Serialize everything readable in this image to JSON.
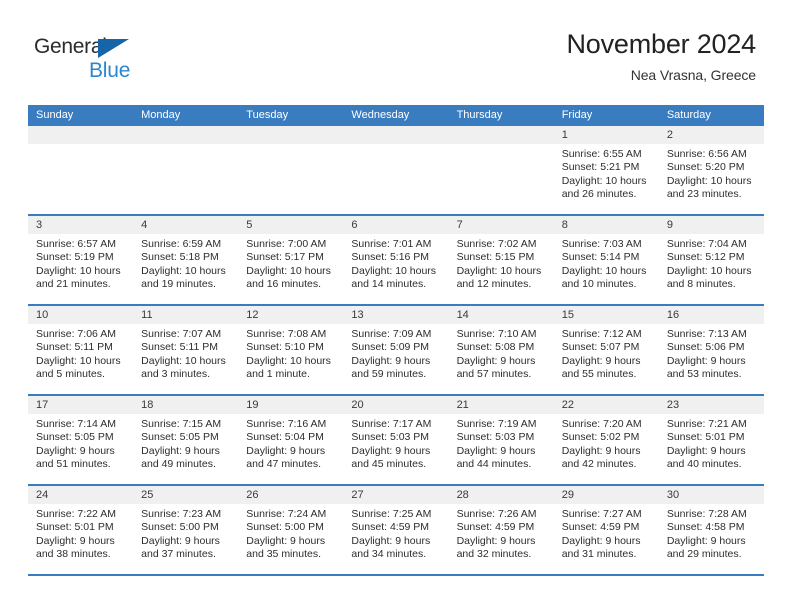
{
  "brand": {
    "name_part1": "General",
    "name_part2": "Blue",
    "accent_color": "#2a87d0",
    "triangle_color": "#1565a8"
  },
  "header": {
    "title": "November 2024",
    "subtitle": "Nea Vrasna, Greece",
    "header_bg_color": "#3a7cc0"
  },
  "weekdays": [
    "Sunday",
    "Monday",
    "Tuesday",
    "Wednesday",
    "Thursday",
    "Friday",
    "Saturday"
  ],
  "weeks": [
    [
      {
        "day": "",
        "empty": true
      },
      {
        "day": "",
        "empty": true
      },
      {
        "day": "",
        "empty": true
      },
      {
        "day": "",
        "empty": true
      },
      {
        "day": "",
        "empty": true
      },
      {
        "day": "1",
        "sunrise": "Sunrise: 6:55 AM",
        "sunset": "Sunset: 5:21 PM",
        "daylight": "Daylight: 10 hours and 26 minutes."
      },
      {
        "day": "2",
        "sunrise": "Sunrise: 6:56 AM",
        "sunset": "Sunset: 5:20 PM",
        "daylight": "Daylight: 10 hours and 23 minutes."
      }
    ],
    [
      {
        "day": "3",
        "sunrise": "Sunrise: 6:57 AM",
        "sunset": "Sunset: 5:19 PM",
        "daylight": "Daylight: 10 hours and 21 minutes."
      },
      {
        "day": "4",
        "sunrise": "Sunrise: 6:59 AM",
        "sunset": "Sunset: 5:18 PM",
        "daylight": "Daylight: 10 hours and 19 minutes."
      },
      {
        "day": "5",
        "sunrise": "Sunrise: 7:00 AM",
        "sunset": "Sunset: 5:17 PM",
        "daylight": "Daylight: 10 hours and 16 minutes."
      },
      {
        "day": "6",
        "sunrise": "Sunrise: 7:01 AM",
        "sunset": "Sunset: 5:16 PM",
        "daylight": "Daylight: 10 hours and 14 minutes."
      },
      {
        "day": "7",
        "sunrise": "Sunrise: 7:02 AM",
        "sunset": "Sunset: 5:15 PM",
        "daylight": "Daylight: 10 hours and 12 minutes."
      },
      {
        "day": "8",
        "sunrise": "Sunrise: 7:03 AM",
        "sunset": "Sunset: 5:14 PM",
        "daylight": "Daylight: 10 hours and 10 minutes."
      },
      {
        "day": "9",
        "sunrise": "Sunrise: 7:04 AM",
        "sunset": "Sunset: 5:12 PM",
        "daylight": "Daylight: 10 hours and 8 minutes."
      }
    ],
    [
      {
        "day": "10",
        "sunrise": "Sunrise: 7:06 AM",
        "sunset": "Sunset: 5:11 PM",
        "daylight": "Daylight: 10 hours and 5 minutes."
      },
      {
        "day": "11",
        "sunrise": "Sunrise: 7:07 AM",
        "sunset": "Sunset: 5:11 PM",
        "daylight": "Daylight: 10 hours and 3 minutes."
      },
      {
        "day": "12",
        "sunrise": "Sunrise: 7:08 AM",
        "sunset": "Sunset: 5:10 PM",
        "daylight": "Daylight: 10 hours and 1 minute."
      },
      {
        "day": "13",
        "sunrise": "Sunrise: 7:09 AM",
        "sunset": "Sunset: 5:09 PM",
        "daylight": "Daylight: 9 hours and 59 minutes."
      },
      {
        "day": "14",
        "sunrise": "Sunrise: 7:10 AM",
        "sunset": "Sunset: 5:08 PM",
        "daylight": "Daylight: 9 hours and 57 minutes."
      },
      {
        "day": "15",
        "sunrise": "Sunrise: 7:12 AM",
        "sunset": "Sunset: 5:07 PM",
        "daylight": "Daylight: 9 hours and 55 minutes."
      },
      {
        "day": "16",
        "sunrise": "Sunrise: 7:13 AM",
        "sunset": "Sunset: 5:06 PM",
        "daylight": "Daylight: 9 hours and 53 minutes."
      }
    ],
    [
      {
        "day": "17",
        "sunrise": "Sunrise: 7:14 AM",
        "sunset": "Sunset: 5:05 PM",
        "daylight": "Daylight: 9 hours and 51 minutes."
      },
      {
        "day": "18",
        "sunrise": "Sunrise: 7:15 AM",
        "sunset": "Sunset: 5:05 PM",
        "daylight": "Daylight: 9 hours and 49 minutes."
      },
      {
        "day": "19",
        "sunrise": "Sunrise: 7:16 AM",
        "sunset": "Sunset: 5:04 PM",
        "daylight": "Daylight: 9 hours and 47 minutes."
      },
      {
        "day": "20",
        "sunrise": "Sunrise: 7:17 AM",
        "sunset": "Sunset: 5:03 PM",
        "daylight": "Daylight: 9 hours and 45 minutes."
      },
      {
        "day": "21",
        "sunrise": "Sunrise: 7:19 AM",
        "sunset": "Sunset: 5:03 PM",
        "daylight": "Daylight: 9 hours and 44 minutes."
      },
      {
        "day": "22",
        "sunrise": "Sunrise: 7:20 AM",
        "sunset": "Sunset: 5:02 PM",
        "daylight": "Daylight: 9 hours and 42 minutes."
      },
      {
        "day": "23",
        "sunrise": "Sunrise: 7:21 AM",
        "sunset": "Sunset: 5:01 PM",
        "daylight": "Daylight: 9 hours and 40 minutes."
      }
    ],
    [
      {
        "day": "24",
        "sunrise": "Sunrise: 7:22 AM",
        "sunset": "Sunset: 5:01 PM",
        "daylight": "Daylight: 9 hours and 38 minutes."
      },
      {
        "day": "25",
        "sunrise": "Sunrise: 7:23 AM",
        "sunset": "Sunset: 5:00 PM",
        "daylight": "Daylight: 9 hours and 37 minutes."
      },
      {
        "day": "26",
        "sunrise": "Sunrise: 7:24 AM",
        "sunset": "Sunset: 5:00 PM",
        "daylight": "Daylight: 9 hours and 35 minutes."
      },
      {
        "day": "27",
        "sunrise": "Sunrise: 7:25 AM",
        "sunset": "Sunset: 4:59 PM",
        "daylight": "Daylight: 9 hours and 34 minutes."
      },
      {
        "day": "28",
        "sunrise": "Sunrise: 7:26 AM",
        "sunset": "Sunset: 4:59 PM",
        "daylight": "Daylight: 9 hours and 32 minutes."
      },
      {
        "day": "29",
        "sunrise": "Sunrise: 7:27 AM",
        "sunset": "Sunset: 4:59 PM",
        "daylight": "Daylight: 9 hours and 31 minutes."
      },
      {
        "day": "30",
        "sunrise": "Sunrise: 7:28 AM",
        "sunset": "Sunset: 4:58 PM",
        "daylight": "Daylight: 9 hours and 29 minutes."
      }
    ]
  ]
}
